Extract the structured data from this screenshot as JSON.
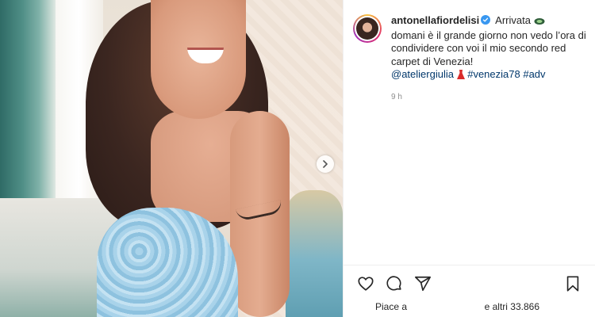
{
  "post": {
    "username": "antonellafiordelisi",
    "caption_parts": {
      "lead": "Arrivata ",
      "body": "domani è il grande giorno non vedo l’ora di condividere con voi il mio secondo red carpet di Venezia!",
      "mention": "@ateliergiulia",
      "hashtags": [
        "#venezia78",
        "#adv"
      ]
    },
    "time": "9 h"
  },
  "likes": {
    "label_left": "Piace a",
    "label_right": "e altri 33.866"
  },
  "icons": {
    "verified": "verified-badge-icon",
    "like": "heart-icon",
    "comment": "comment-icon",
    "share": "share-icon",
    "save": "bookmark-icon",
    "next": "chevron-right-icon"
  },
  "colors": {
    "verified": "#3897f0",
    "link": "#00376b",
    "muted": "#8e8e8e",
    "dress_emoji": "#d92b2b"
  }
}
